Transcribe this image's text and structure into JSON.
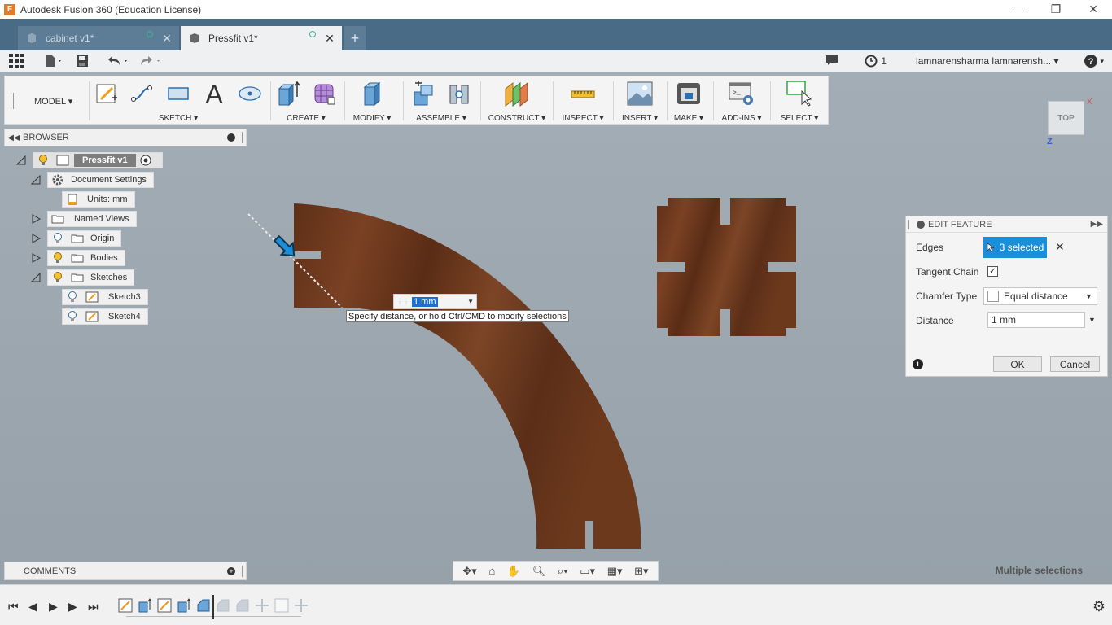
{
  "window": {
    "title": "Autodesk Fusion 360 (Education License)",
    "controls": [
      "—",
      "❐",
      "✕"
    ]
  },
  "tabs": [
    {
      "label": "cabinet v1*",
      "active": false
    },
    {
      "label": "Pressfit v1*",
      "active": true
    }
  ],
  "quickbar": {
    "notification_count": "1",
    "user": "lamnarensharma lamnarensh..."
  },
  "toolbar": {
    "workspace": "MODEL",
    "groups": [
      "SKETCH",
      "CREATE",
      "MODIFY",
      "ASSEMBLE",
      "CONSTRUCT",
      "INSPECT",
      "INSERT",
      "MAKE",
      "ADD-INS",
      "SELECT"
    ]
  },
  "browser": {
    "title": "BROWSER",
    "items": [
      {
        "label": "Pressfit v1"
      },
      {
        "label": "Document Settings"
      },
      {
        "label": "Units: mm"
      },
      {
        "label": "Named Views"
      },
      {
        "label": "Origin"
      },
      {
        "label": "Bodies"
      },
      {
        "label": "Sketches"
      },
      {
        "label": "Sketch3"
      },
      {
        "label": "Sketch4"
      }
    ]
  },
  "comments": {
    "title": "COMMENTS"
  },
  "viewcube": {
    "face": "TOP",
    "x": "X",
    "z": "Z"
  },
  "canvas_input": {
    "value": "1 mm",
    "tooltip": "Specify distance, or hold Ctrl/CMD to modify selections"
  },
  "dialog": {
    "title": "EDIT FEATURE",
    "edges_label": "Edges",
    "edges_value": "3 selected",
    "tangent_label": "Tangent Chain",
    "tangent_checked": true,
    "chamfer_label": "Chamfer Type",
    "chamfer_value": "Equal distance",
    "distance_label": "Distance",
    "distance_value": "1 mm",
    "ok": "OK",
    "cancel": "Cancel"
  },
  "status": {
    "text": "Multiple selections"
  },
  "colors": {
    "accent": "#1a8ed8",
    "wood": "#6b3a20",
    "tabbar": "#4a6b86"
  }
}
